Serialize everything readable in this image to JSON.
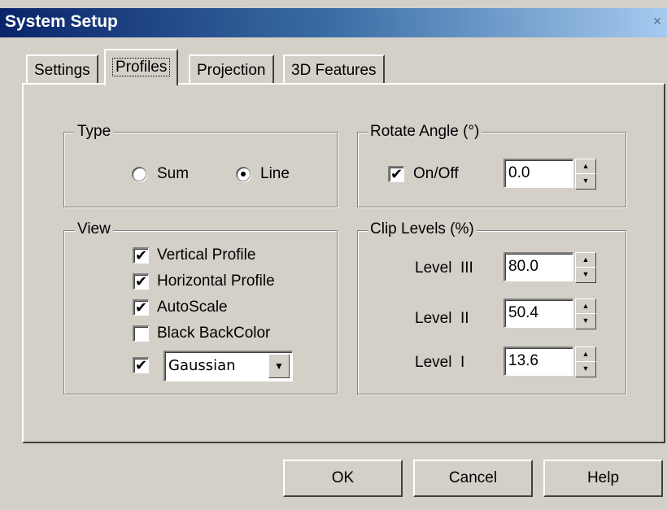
{
  "window": {
    "title": "System Setup",
    "close_glyph": "×"
  },
  "tabs": [
    {
      "label": "Settings"
    },
    {
      "label": "Profiles",
      "active": true
    },
    {
      "label": "Projection"
    },
    {
      "label": "3D Features"
    }
  ],
  "type_group": {
    "title": "Type",
    "options": [
      {
        "label": "Sum",
        "selected": false
      },
      {
        "label": "Line",
        "selected": true
      }
    ]
  },
  "rotate_group": {
    "title": "Rotate Angle (°)",
    "toggle_label": "On/Off",
    "toggle_checked": true,
    "value": "0.0"
  },
  "view_group": {
    "title": "View",
    "items": [
      {
        "label": "Vertical Profile",
        "checked": true
      },
      {
        "label": "Horizontal Profile",
        "checked": true
      },
      {
        "label": "AutoScale",
        "checked": true
      },
      {
        "label": "Black BackColor",
        "checked": false
      }
    ],
    "filter_checked": true,
    "filter_value": "Gaussian"
  },
  "clip_group": {
    "title": "Clip Levels (%)",
    "levels": [
      {
        "label": "Level  III",
        "value": "80.0"
      },
      {
        "label": "Level  II",
        "value": "50.4"
      },
      {
        "label": "Level  I",
        "value": "13.6"
      }
    ]
  },
  "buttons": {
    "ok": "OK",
    "cancel": "Cancel",
    "help": "Help"
  },
  "glyphs": {
    "check": "✔",
    "arrow_up": "▲",
    "arrow_down": "▼"
  }
}
